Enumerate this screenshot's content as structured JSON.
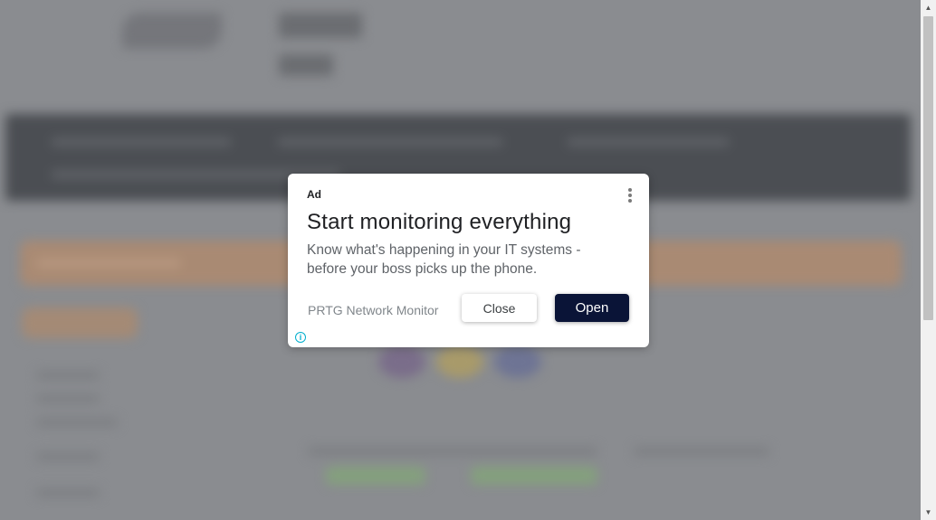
{
  "ad": {
    "label": "Ad",
    "headline": "Start monitoring everything",
    "body": "Know what's happening in your IT systems - before your boss picks up the phone.",
    "advertiser": "PRTG Network Monitor",
    "close_label": "Close",
    "open_label": "Open",
    "info_glyph": "i",
    "menu_icon": "more-vert-icon"
  },
  "colors": {
    "open_button": "#0a1437",
    "info_icon": "#00aecd",
    "overlay": "#8a8c90"
  }
}
